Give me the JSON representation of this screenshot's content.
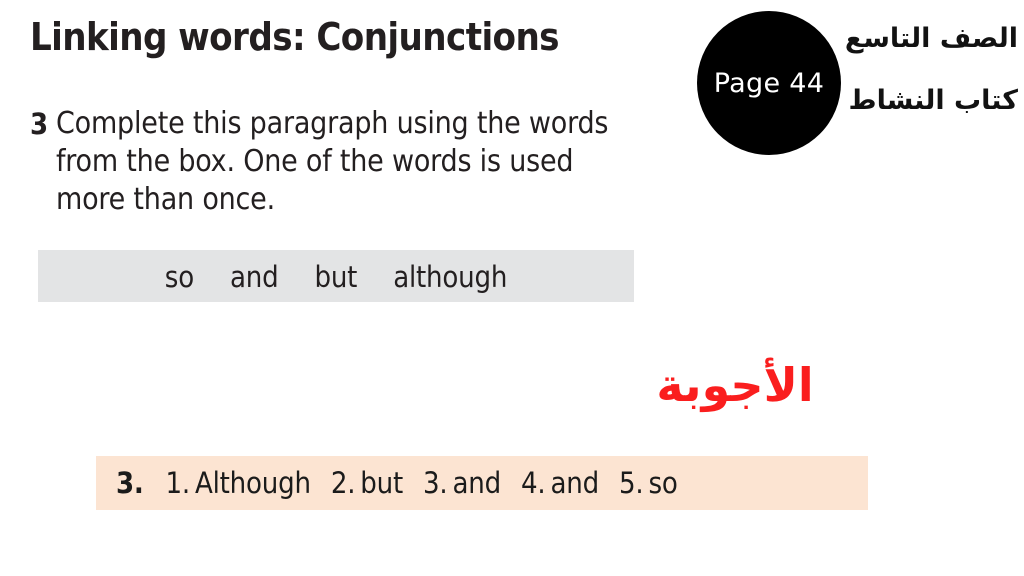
{
  "worksheet": {
    "title": "Linking words: Conjunctions",
    "exercise": {
      "number": "3",
      "instruction": "Complete this paragraph using the words from the box. One of the words is used more than once."
    },
    "word_box": {
      "words": [
        "so",
        "and",
        "but",
        "although"
      ],
      "background_color": "#e3e4e5"
    }
  },
  "badge": {
    "page_label": "Page 44",
    "background_color": "#000000",
    "text_color": "#ffffff"
  },
  "header_labels": {
    "grade": "الصف التاسع",
    "book": "كتاب النشاط"
  },
  "answers": {
    "heading": "الأجوبة",
    "heading_color": "#fa1e1e",
    "bar_background_color": "#fce4d2",
    "question_number": "3.",
    "items": [
      {
        "index": "1.",
        "value": "Although"
      },
      {
        "index": "2.",
        "value": "but"
      },
      {
        "index": "3.",
        "value": "and"
      },
      {
        "index": "4.",
        "value": "and"
      },
      {
        "index": "5.",
        "value": "so"
      }
    ]
  }
}
